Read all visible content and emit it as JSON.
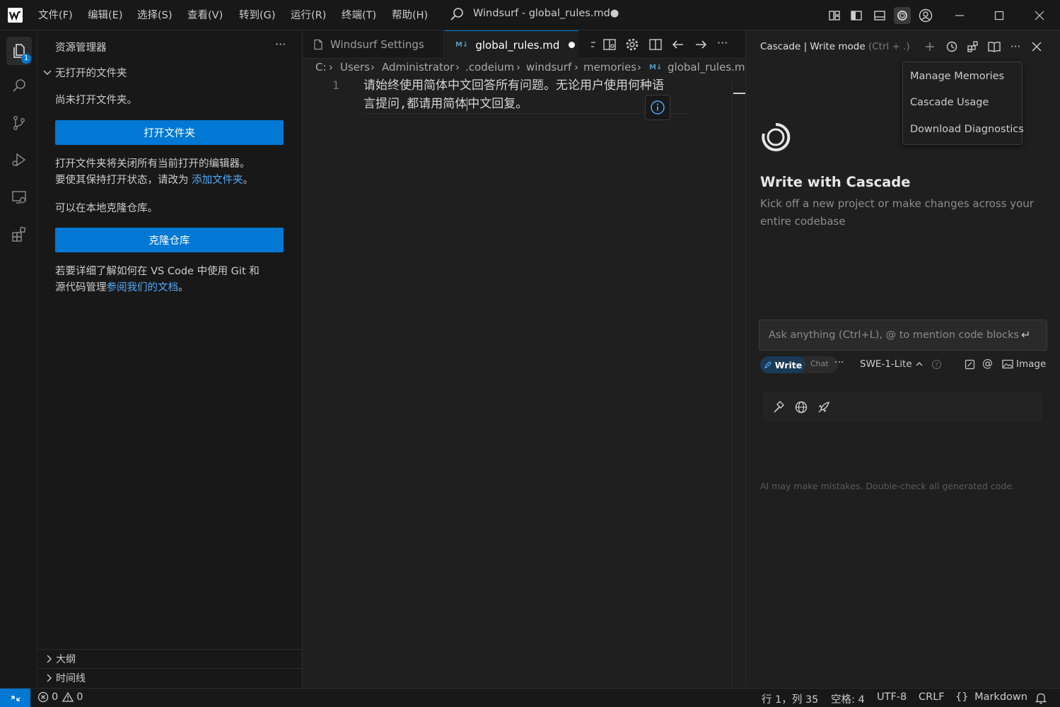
{
  "title_bar": {
    "menus": [
      "文件(F)",
      "编辑(E)",
      "选择(S)",
      "查看(V)",
      "转到(G)",
      "运行(R)",
      "终端(T)",
      "帮助(H)"
    ],
    "search_title": "Windsurf - global_rules.md●"
  },
  "activity_bar": {
    "explorer_badge": "1"
  },
  "sidebar": {
    "title": "资源管理器",
    "more": "···",
    "section_title": "无打开的文件夹",
    "no_folder_text": "尚未打开文件夹。",
    "open_folder_button": "打开文件夹",
    "info_line1": "打开文件夹将关闭所有当前打开的编辑器。",
    "info_line2_prefix": "要使其保持打开状态，请改为 ",
    "info_line2_link": "添加文件夹",
    "info_line2_suffix": "。",
    "clone_text": "可以在本地克隆仓库。",
    "clone_button": "克隆仓库",
    "git_line1": "若要详细了解如何在 VS Code 中使用 Git 和",
    "git_line2_prefix": "源代码管理",
    "git_line2_link": "参阅我们的文档",
    "git_line2_suffix": "。",
    "outline": "大纲",
    "timeline": "时间线"
  },
  "editor": {
    "tabs": [
      {
        "label": "Windsurf Settings",
        "active": false
      },
      {
        "label": "global_rules.md",
        "active": true,
        "modified": true
      }
    ],
    "md_badge": "M↓",
    "breadcrumb": [
      "C:",
      "Users",
      "Administrator",
      ".codeium",
      "windsurf",
      "memories",
      "global_rules.md"
    ],
    "line_number": "1",
    "line_text_1": "请始终使用简体中文回答所有问题。无论用户使用何种语",
    "line_text_2a": "言提问,都请用简体",
    "line_text_2b": "中文回复。"
  },
  "cascade": {
    "header_title": "Cascade | Write mode",
    "header_shortcut": "(Ctrl + .)",
    "menu_items": [
      "Manage Memories",
      "Cascade Usage",
      "Download Diagnostics"
    ],
    "heading": "Write with Cascade",
    "subtext_line1": "Kick off a new project or make changes across your",
    "subtext_line2": "entire codebase",
    "input_placeholder": "Ask anything (Ctrl+L), @ to mention code blocks",
    "mode_write": "Write",
    "mode_chat": "Chat",
    "mode_more": "···",
    "model": "SWE-1-Lite",
    "image_label": "Image",
    "disclaimer": "AI may make mistakes. Double-check all generated code."
  },
  "status_bar": {
    "errors": "0",
    "warnings": "0",
    "position": "行 1，列 35",
    "spaces": "空格: 4",
    "encoding": "UTF-8",
    "eol": "CRLF",
    "language": "Markdown"
  },
  "colors": {
    "accent": "#0078d4",
    "link": "#4daafc",
    "background": "#1f1f1f",
    "panel": "#181818"
  }
}
